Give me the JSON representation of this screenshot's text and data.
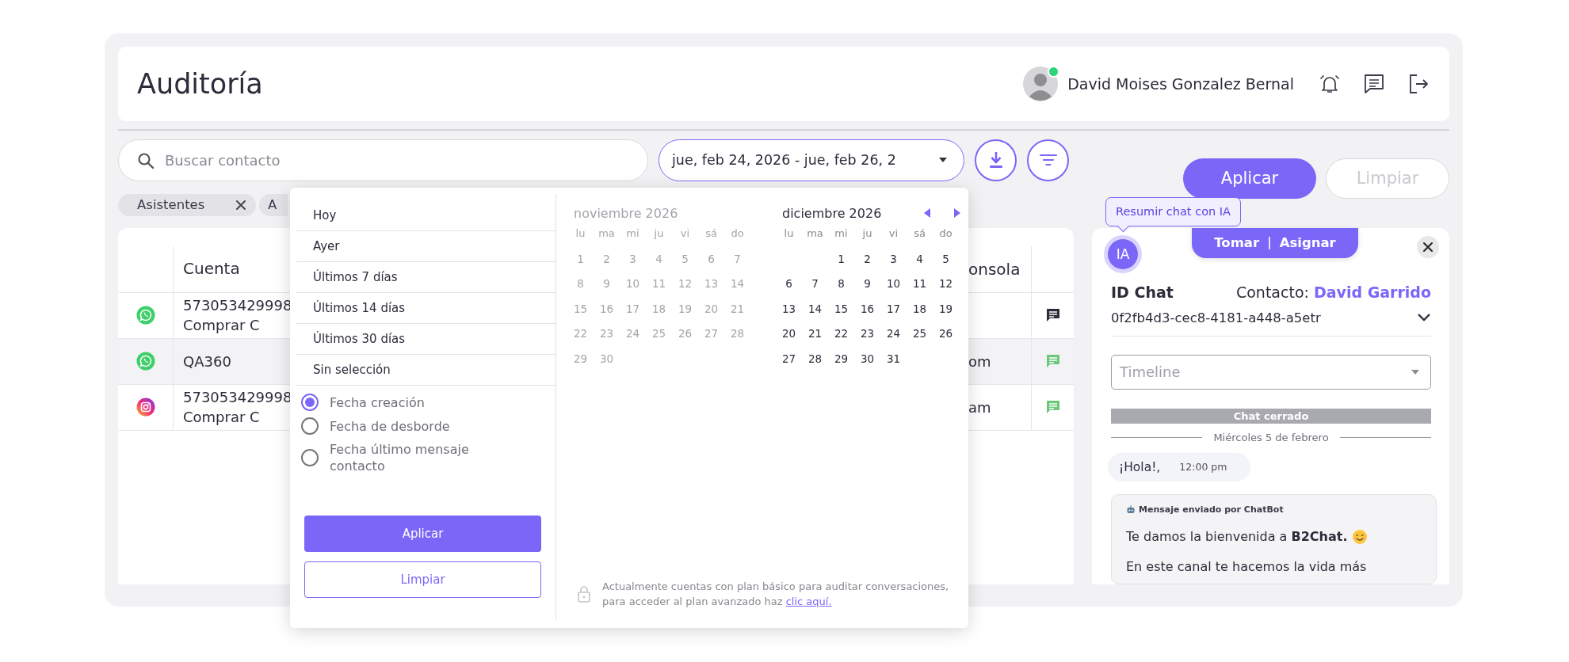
{
  "header": {
    "title": "Auditoría",
    "user": {
      "name": "David Moises Gonzalez Bernal",
      "online": true
    }
  },
  "search": {
    "placeholder": "Buscar contacto"
  },
  "date_range": {
    "value": "jue, feb 24, 2026 - jue, feb 26, 2"
  },
  "actions": [
    {
      "label": "Aplicar",
      "disabled": false
    },
    {
      "label": "Limpiar",
      "disabled": true
    }
  ],
  "filter_chips": [
    {
      "label": "Asistentes",
      "removable": true
    },
    {
      "label": "A"
    }
  ],
  "table": {
    "columns": {
      "account": "Cuenta",
      "column_3": "onsola"
    },
    "rows": [
      {
        "kind": "whatsapp",
        "account": [
          "573053429998",
          "Comprar C"
        ],
        "color": "#2c2c3a",
        "selected": false
      },
      {
        "kind": "whatsapp",
        "account": [
          "QA360"
        ],
        "column_3": "om",
        "color": "#6cc77a",
        "selected": true
      },
      {
        "kind": "instagram",
        "account": [
          "573053429998",
          "Comprar C"
        ],
        "column_3": "am",
        "color": "#6cc77a",
        "selected": false
      }
    ]
  },
  "date_picker": {
    "presets": [
      {
        "label": "Hoy"
      },
      {
        "label": "Ayer"
      },
      {
        "label": "Últimos 7 días"
      },
      {
        "label": "Últimos 14 días"
      },
      {
        "label": "Últimos 30 días"
      },
      {
        "label": "Sin selección"
      }
    ],
    "date_types": [
      {
        "label": "Fecha creación",
        "selected": true
      },
      {
        "label": "Fecha de desborde",
        "selected": false
      },
      {
        "label": "Fecha último mensaje contacto",
        "selected": false
      }
    ],
    "buttons": [
      {
        "label": "Aplicar",
        "kind": "primary"
      },
      {
        "label": "Limpiar",
        "kind": "outline"
      }
    ],
    "months": [
      {
        "title": "noviembre 2026",
        "disabled": true,
        "weekdays": [
          "lu",
          "ma",
          "mi",
          "ju",
          "vi",
          "sá",
          "do"
        ],
        "weeks": [
          [
            "1",
            "2",
            "3",
            "4",
            "5",
            "6",
            "7"
          ],
          [
            "8",
            "9",
            "10",
            "11",
            "12",
            "13",
            "14"
          ],
          [
            "15",
            "16",
            "17",
            "18",
            "19",
            "20",
            "21"
          ],
          [
            "22",
            "23",
            "24",
            "25",
            "26",
            "27",
            "28"
          ],
          [
            "29",
            "30"
          ]
        ]
      },
      {
        "title": "diciembre 2026",
        "disabled": false,
        "weekdays": [
          "lu",
          "ma",
          "mi",
          "ju",
          "vi",
          "sá",
          "do"
        ],
        "weeks": [
          [
            "1",
            "2",
            "3",
            "4",
            "5"
          ],
          [
            "6",
            "7",
            "8",
            "9",
            "10",
            "11",
            "12"
          ],
          [
            "13",
            "14",
            "15",
            "16",
            "17",
            "18",
            "19"
          ],
          [
            "20",
            "21",
            "22",
            "23",
            "24",
            "25",
            "26"
          ],
          [
            "27",
            "28",
            "29",
            "30",
            "31"
          ]
        ]
      }
    ],
    "note": {
      "text": "Actualmente cuentas con plan básico para auditar conversaciones, para acceder al plan avanzado haz",
      "link": "clic aquí."
    }
  },
  "chat_panel": {
    "tooltip": "Resumir chat con IA",
    "ai_badge": "IA",
    "actions": [
      "Tomar",
      "Asignar"
    ],
    "id_label": "ID Chat",
    "contact_label": "Contacto:",
    "contact_name": "David Garrido",
    "chat_id": "0f2fb4d3-cec8-4181-a448-a5etr",
    "timeline": {
      "placeholder": "Timeline"
    },
    "status": "Chat cerrado",
    "date_divider": "Miércoles 5 de febrero",
    "messages": [
      {
        "kind": "incoming",
        "text": "¡Hola!,",
        "time": "12:00 pm"
      },
      {
        "kind": "bot",
        "sender": "Mensaje enviado por ChatBot",
        "paragraphs": [
          "Te damos la bienvenida a **B2Chat.**",
          "En este canal te hacemos la vida más"
        ]
      }
    ]
  }
}
